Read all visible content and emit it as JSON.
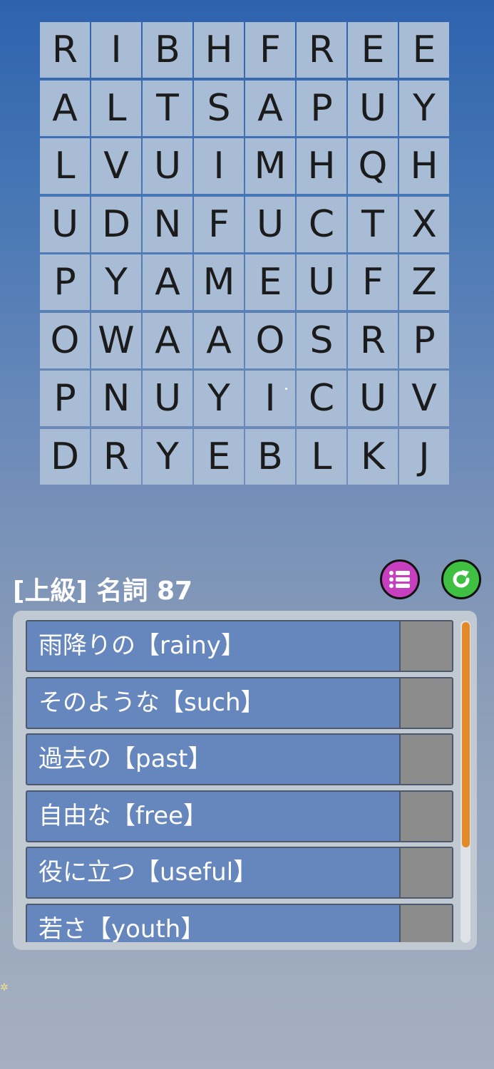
{
  "grid": {
    "rows": [
      [
        "R",
        "I",
        "B",
        "H",
        "F",
        "R",
        "E",
        "E"
      ],
      [
        "A",
        "L",
        "T",
        "S",
        "A",
        "P",
        "U",
        "Y"
      ],
      [
        "L",
        "V",
        "U",
        "I",
        "M",
        "H",
        "Q",
        "H"
      ],
      [
        "U",
        "D",
        "N",
        "F",
        "U",
        "C",
        "T",
        "X"
      ],
      [
        "P",
        "Y",
        "A",
        "M",
        "E",
        "U",
        "F",
        "Z"
      ],
      [
        "O",
        "W",
        "A",
        "A",
        "O",
        "S",
        "R",
        "P"
      ],
      [
        "P",
        "N",
        "U",
        "Y",
        "I",
        "C",
        "U",
        "V"
      ],
      [
        "D",
        "R",
        "Y",
        "E",
        "B",
        "L",
        "K",
        "J"
      ]
    ]
  },
  "header": {
    "title": "[上級] 名詞 87"
  },
  "buttons": {
    "list_icon": "list-icon",
    "reset_icon": "refresh-icon"
  },
  "words": [
    "雨降りの【rainy】",
    "そのような【such】",
    "過去の【past】",
    "自由な【free】",
    "役に立つ【useful】",
    "若さ【youth】"
  ],
  "colors": {
    "list_button": "#c63fbf",
    "reset_button": "#3fc043",
    "row": "#6686be",
    "scroll_thumb": "#e38a28"
  }
}
